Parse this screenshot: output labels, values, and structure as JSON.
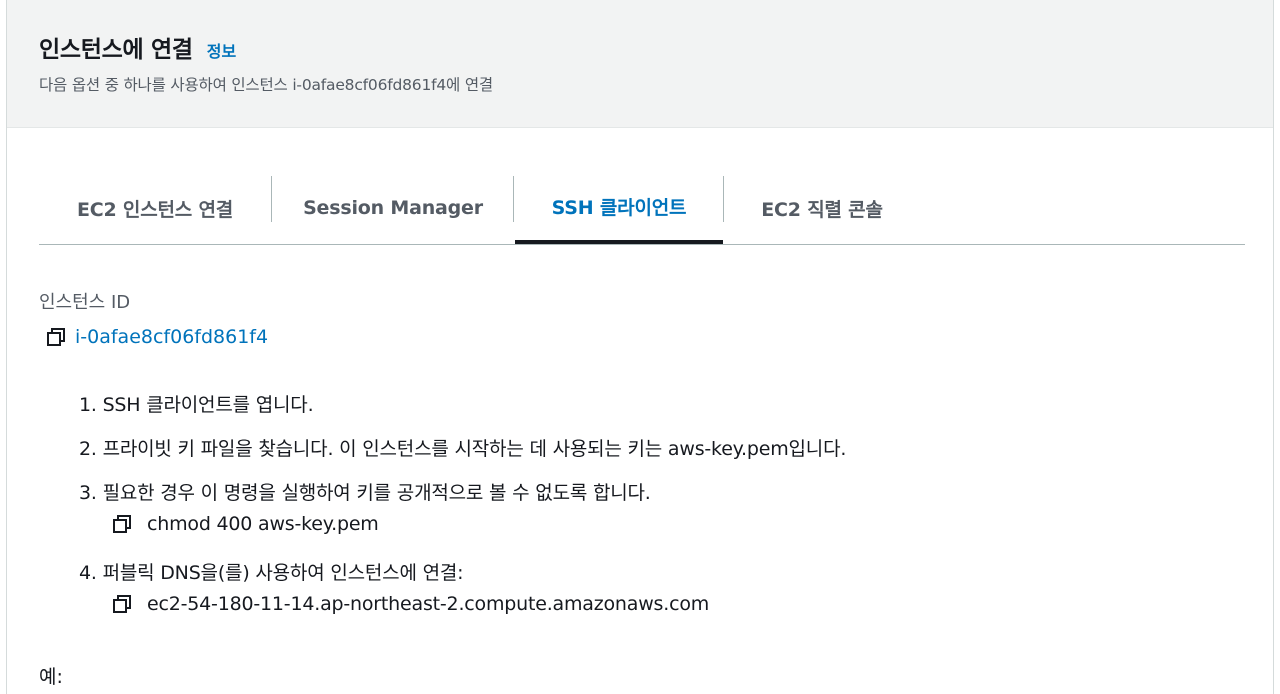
{
  "header": {
    "title": "인스턴스에 연결",
    "info_link": "정보",
    "subtitle": "다음 옵션 중 하나를 사용하여 인스턴스 i-0afae8cf06fd861f4에 연결"
  },
  "tabs": [
    {
      "label": "EC2 인스턴스 연결",
      "active": false
    },
    {
      "label": "Session Manager",
      "active": false
    },
    {
      "label": "SSH 클라이언트",
      "active": true
    },
    {
      "label": "EC2 직렬 콘솔",
      "active": false
    }
  ],
  "instance": {
    "label": "인스턴스 ID",
    "id": "i-0afae8cf06fd861f4"
  },
  "steps": [
    {
      "text": "1. SSH 클라이언트를 엽니다."
    },
    {
      "text": "2. 프라이빗 키 파일을 찾습니다. 이 인스턴스를 시작하는 데 사용되는 키는 aws-key.pem입니다."
    },
    {
      "text": "3. 필요한 경우 이 명령을 실행하여 키를 공개적으로 볼 수 없도록 합니다.",
      "command": "chmod 400 aws-key.pem"
    },
    {
      "text": "4. 퍼블릭 DNS을(를) 사용하여 인스턴스에 연결:",
      "command": "ec2-54-180-11-14.ap-northeast-2.compute.amazonaws.com"
    }
  ],
  "example_label": "예:",
  "icons": {
    "copy": "copy-icon"
  },
  "colors": {
    "accent": "#0073bb",
    "text": "#16191f",
    "muted": "#545b64",
    "header_bg": "#f2f3f3"
  }
}
